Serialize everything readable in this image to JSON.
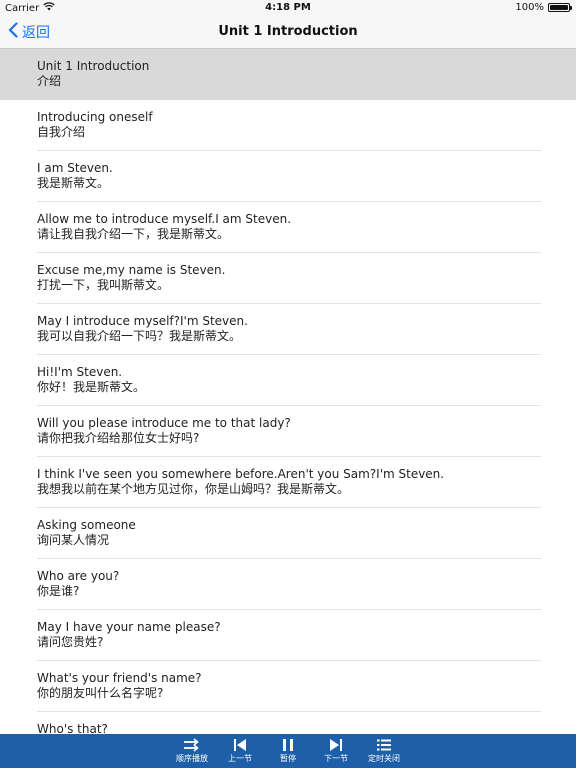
{
  "status_bar": {
    "carrier": "Carrier",
    "time": "4:18 PM",
    "battery": "100%",
    "battery_level": 1.0
  },
  "nav": {
    "back_label": "返回",
    "title": "Unit 1 Introduction"
  },
  "rows": [
    {
      "en": "Unit 1 Introduction",
      "zh": "介绍",
      "selected": true
    },
    {
      "en": "Introducing oneself",
      "zh": "自我介绍"
    },
    {
      "en": "I am Steven.",
      "zh": "我是斯蒂文。"
    },
    {
      "en": "Allow me to introduce myself.I am Steven.",
      "zh": "请让我自我介绍一下，我是斯蒂文。"
    },
    {
      "en": "Excuse me,my name is Steven.",
      "zh": "打扰一下，我叫斯蒂文。"
    },
    {
      "en": "May I introduce myself?I'm Steven.",
      "zh": "我可以自我介绍一下吗？我是斯蒂文。"
    },
    {
      "en": "Hi!I'm Steven.",
      "zh": "你好！我是斯蒂文。"
    },
    {
      "en": "Will you please introduce me to that lady?",
      "zh": "请你把我介绍给那位女士好吗?"
    },
    {
      "en": "I think I've seen you somewhere before.Aren't you Sam?I'm Steven.",
      "zh": "我想我以前在某个地方见过你，你是山姆吗？我是斯蒂文。"
    },
    {
      "en": "Asking someone",
      "zh": "询问某人情况"
    },
    {
      "en": "Who are you?",
      "zh": "你是谁?"
    },
    {
      "en": "May I have your name please?",
      "zh": "请问您贵姓?"
    },
    {
      "en": "What's your friend's name?",
      "zh": "你的朋友叫什么名字呢?"
    },
    {
      "en": "Who's that?",
      "zh": ""
    }
  ],
  "toolbar": {
    "order_play": {
      "label": "顺序播放",
      "icon": "shuffle-icon"
    },
    "prev": {
      "label": "上一节",
      "icon": "skip-back-icon"
    },
    "pause": {
      "label": "暂停",
      "icon": "pause-icon"
    },
    "next": {
      "label": "下一节",
      "icon": "skip-forward-icon"
    },
    "timer": {
      "label": "定时关闭",
      "icon": "list-icon"
    }
  },
  "colors": {
    "accent": "#1a73e8",
    "toolbar_bg": "#1d5fa8",
    "selected_row": "#d9d9d9"
  }
}
